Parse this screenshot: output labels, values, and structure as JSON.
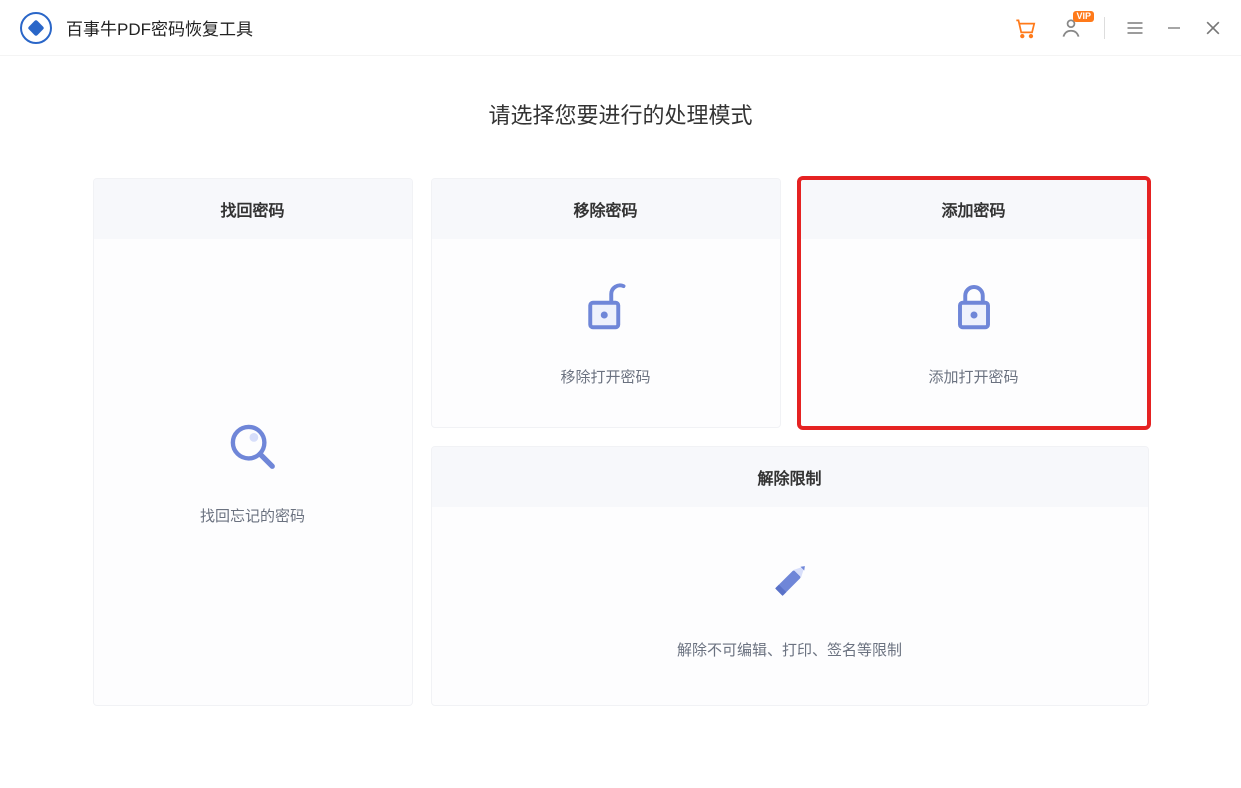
{
  "app": {
    "title": "百事牛PDF密码恢复工具"
  },
  "titlebar": {
    "vip_badge": "VIP"
  },
  "main": {
    "heading": "请选择您要进行的处理模式"
  },
  "cards": {
    "recover": {
      "title": "找回密码",
      "desc": "找回忘记的密码"
    },
    "remove": {
      "title": "移除密码",
      "desc": "移除打开密码"
    },
    "add": {
      "title": "添加密码",
      "desc": "添加打开密码"
    },
    "unrestrict": {
      "title": "解除限制",
      "desc": "解除不可编辑、打印、签名等限制"
    }
  },
  "colors": {
    "accent": "#6f86d8",
    "highlight": "#e52222"
  }
}
